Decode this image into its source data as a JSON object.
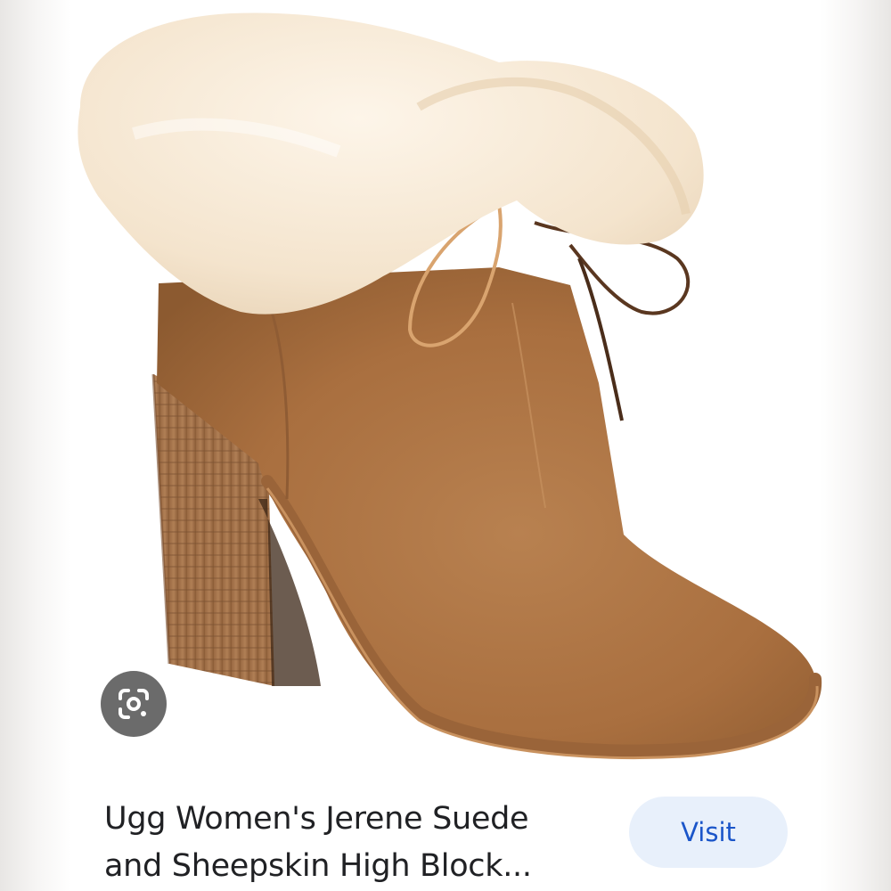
{
  "product": {
    "title_line1": "Ugg Women's Jerene Suede",
    "title_line2": "and Sheepskin High Block..."
  },
  "actions": {
    "visit_label": "Visit",
    "lens_icon": "google-lens-icon"
  },
  "colors": {
    "suede": "#b17a4a",
    "sheepskin": "#f6e9d6",
    "accent": "#1a55c9",
    "button_bg": "#e8f0fb"
  }
}
